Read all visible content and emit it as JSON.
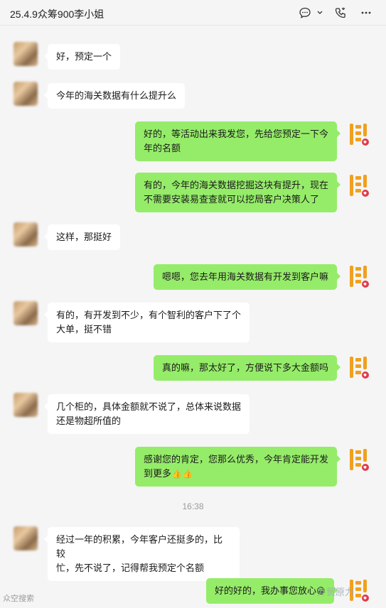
{
  "window": {
    "title": "25.4.9众筹900李小姐"
  },
  "messages": [
    {
      "side": "left",
      "text": "好，预定一个"
    },
    {
      "side": "left",
      "text": "今年的海关数据有什么提升么"
    },
    {
      "side": "right",
      "lines": [
        "好的，等活动出来我发您，先给您预定一下今",
        "年的名额"
      ]
    },
    {
      "side": "right",
      "lines": [
        "有的，今年的海关数据挖掘这块有提升，现在",
        "不需要安装易查查就可以挖局客户决策人了"
      ]
    },
    {
      "side": "left",
      "text": "这样，那挺好"
    },
    {
      "side": "right",
      "text": "嗯嗯，您去年用海关数据有开发到客户嘛"
    },
    {
      "side": "left",
      "lines": [
        "有的，有开发到不少，有个智利的客户下了个",
        "大单，挺不错"
      ]
    },
    {
      "side": "right",
      "text": "真的嘛，那太好了，方便说下多大金额吗"
    },
    {
      "side": "left",
      "lines": [
        "几个柜的，具体金额就不说了，总体来说数据",
        "还是物超所值的"
      ]
    },
    {
      "side": "right",
      "lines": [
        "感谢您的肯定，您那么优秀，今年肯定能开发",
        "到更多"
      ],
      "emojis": "👍👍"
    },
    {
      "side": "left",
      "lines": [
        "经过一年的积累，今年客户还挺多的，比较",
        "忙，先不说了，记得帮我预定个名额"
      ]
    },
    {
      "side": "right",
      "text": "好的好的，我办事您放心",
      "emojis": "😁"
    }
  ],
  "timestamp": "16:38",
  "watermark": {
    "left": "众空搜索",
    "right": "外贸原力"
  },
  "icons": {
    "chat": "chat-bubble-icon",
    "chevron": "chevron-down-icon",
    "call": "phone-icon",
    "more": "more-icon"
  }
}
